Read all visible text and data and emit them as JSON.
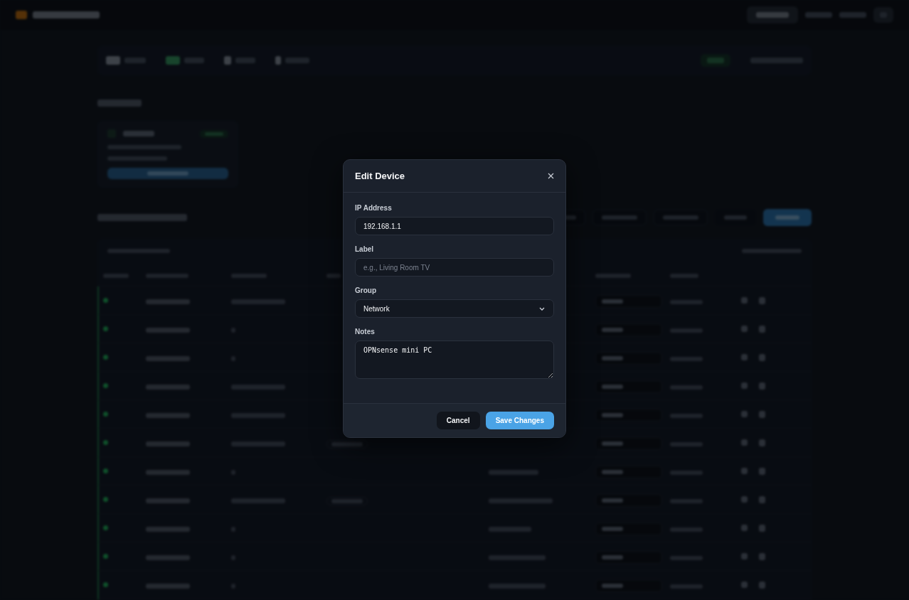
{
  "modal": {
    "title": "Edit Device",
    "fields": [
      {
        "kind": "input",
        "label": "IP Address",
        "value": "192.168.1.1"
      },
      {
        "kind": "input",
        "label": "Label",
        "placeholder": "e.g., Living Room TV"
      },
      {
        "kind": "select",
        "label": "Group",
        "value": "Network"
      },
      {
        "kind": "textarea",
        "label": "Notes",
        "value": "OPNsense mini PC"
      }
    ],
    "cancel": "Cancel",
    "save": "Save Changes"
  }
}
